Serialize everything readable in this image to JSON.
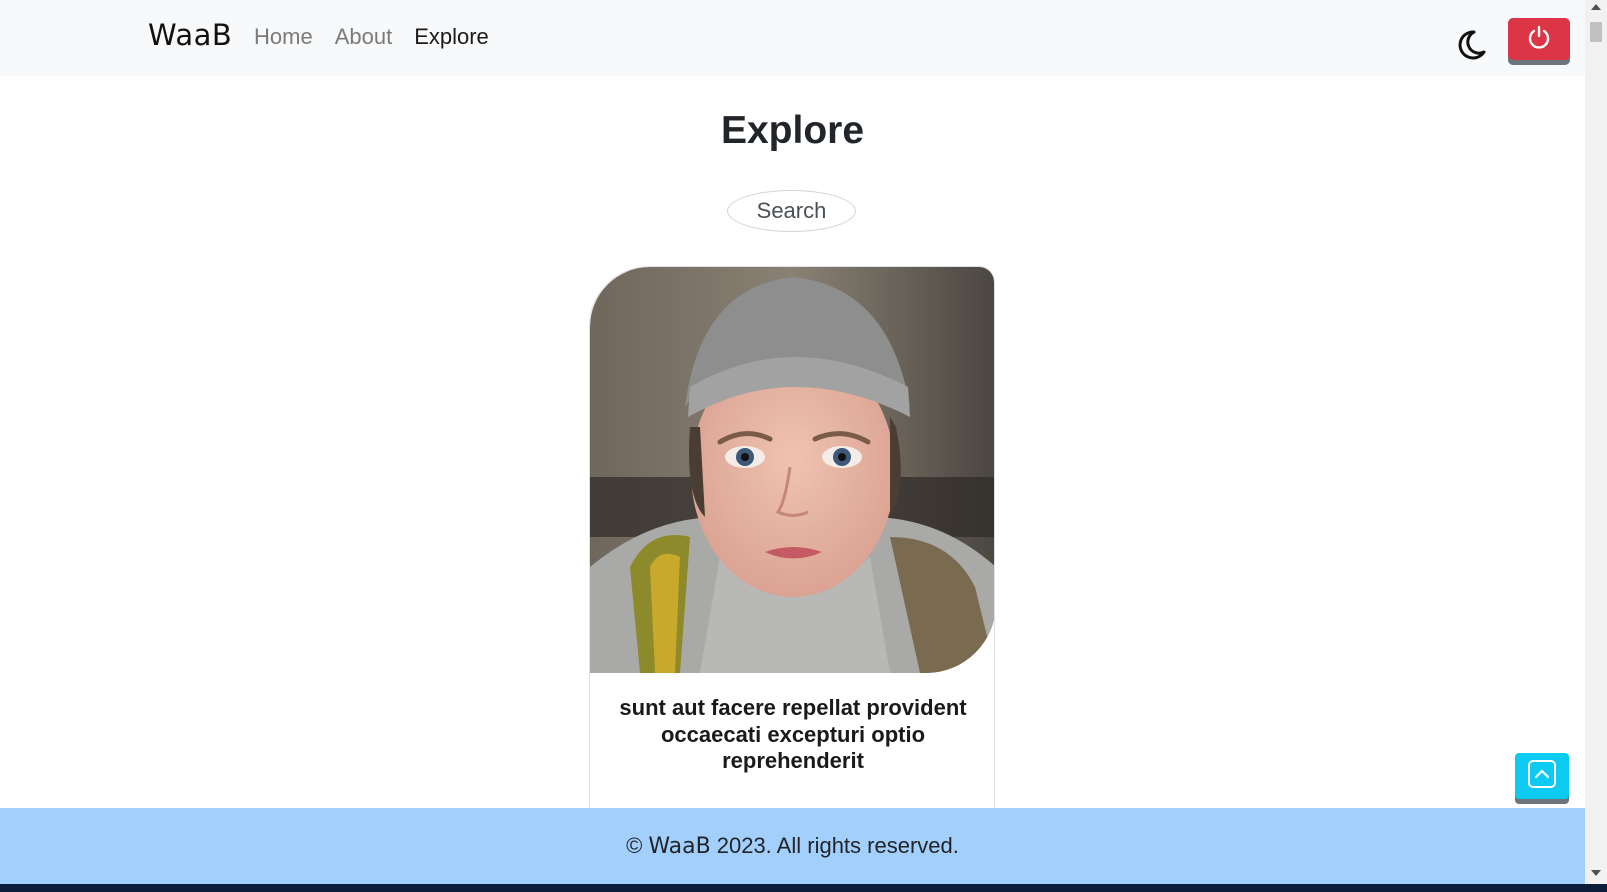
{
  "navbar": {
    "brand": "WaaB",
    "links": [
      {
        "label": "Home",
        "active": false
      },
      {
        "label": "About",
        "active": false
      },
      {
        "label": "Explore",
        "active": true
      }
    ],
    "theme_icon": "moon-icon",
    "power_icon": "power-icon",
    "power_color": "#dc3545"
  },
  "main": {
    "title": "Explore",
    "search": {
      "placeholder": "Search",
      "value": ""
    },
    "card": {
      "image": "portrait photo of a child wearing a grey headband",
      "title": "sunt aut facere repellat provident occaecati excepturi optio reprehenderit"
    }
  },
  "to_top": {
    "icon": "chevron-up-icon",
    "color": "#0dcaf0"
  },
  "footer": {
    "copyright_symbol": "©",
    "brand": "WaaB",
    "text": "2023. All rights reserved.",
    "background": "#a3cffd"
  }
}
